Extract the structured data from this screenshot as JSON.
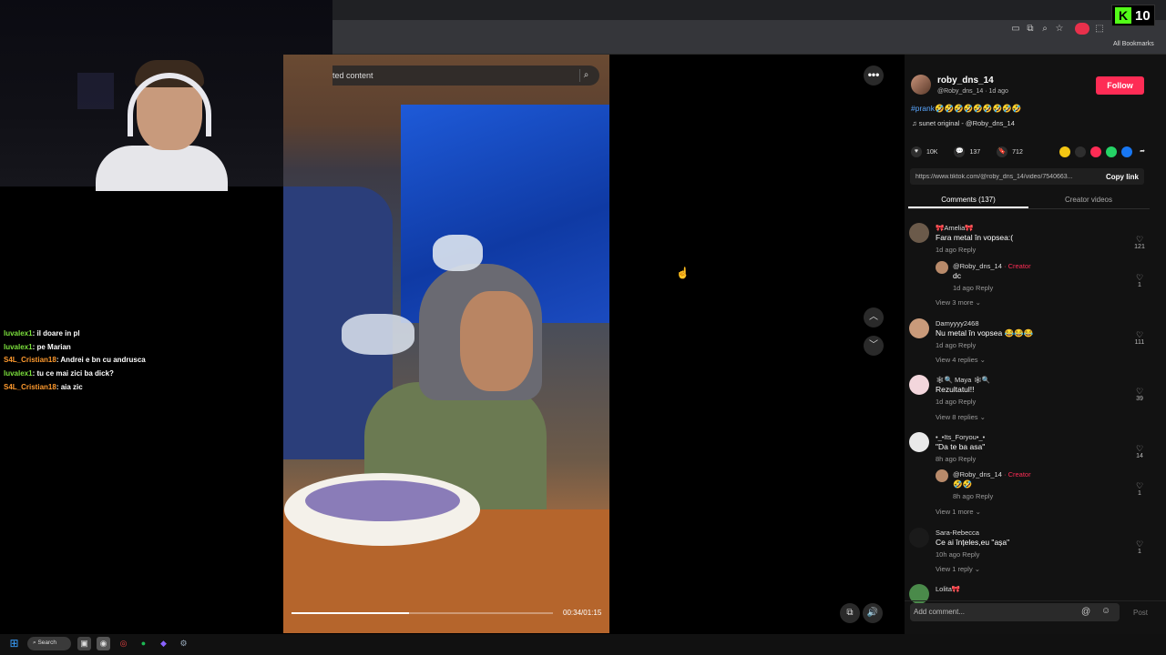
{
  "kick": {
    "count": "10"
  },
  "browser": {
    "all_bookmarks": "All Bookmarks"
  },
  "search": {
    "text": "ted content"
  },
  "video": {
    "time": "00:34/01:15",
    "progress": 0.45
  },
  "chat": [
    {
      "user": "luvalex1",
      "msg": ": il doare in pl",
      "color": "#7be03c"
    },
    {
      "user": "luvalex1",
      "msg": ": pe Marian",
      "color": "#7be03c"
    },
    {
      "user": "S4L_Cristian18",
      "msg": ": Andrei e bn cu andrusca",
      "color": "#ff9a2e"
    },
    {
      "user": "luvalex1",
      "msg": ": tu ce mai zici ba dick?",
      "color": "#7be03c"
    },
    {
      "user": "S4L_Cristian18",
      "msg": ": aia zic",
      "color": "#ff9a2e"
    }
  ],
  "author": {
    "name": "roby_dns_14",
    "sub": "@Roby_dns_14 · 1d ago",
    "follow": "Follow",
    "caption_tag": "#prank",
    "caption_emoji": "🤣🤣🤣🤣🤣🤣🤣🤣🤣",
    "music": "♫  sunet original - @Roby_dns_14"
  },
  "stats": {
    "likes": "10K",
    "comments": "137",
    "saves": "712"
  },
  "link": {
    "url": "https://www.tiktok.com/@roby_dns_14/video/7540663...",
    "copy": "Copy link"
  },
  "tabs": {
    "comments": "Comments (137)",
    "creator": "Creator videos"
  },
  "comments": [
    {
      "name": "🎀Amelia🎀",
      "text": "Fara metal în vopsea:(",
      "meta": "1d ago    Reply",
      "likes": "121"
    },
    {
      "name": "@Roby_dns_14",
      "creator": " · Creator",
      "text": "dc",
      "meta": "1d ago    Reply",
      "likes": "1"
    },
    {
      "more": "View 3 more ⌄"
    },
    {
      "name": "Damyyyy2468",
      "text": "Nu metal în vopsea 😂😂😂",
      "meta": "1d ago    Reply",
      "likes": "111"
    },
    {
      "more": "View 4 replies ⌄"
    },
    {
      "name": "🕸🔍 Maya 🕸🔍",
      "text": "Rezultatul!!",
      "meta": "1d ago    Reply",
      "likes": "39"
    },
    {
      "more": "View 8 replies ⌄"
    },
    {
      "name": "•_•Its_Foryou•_•",
      "text": "\"Da te ba asa\"",
      "meta": "8h ago    Reply",
      "likes": "14"
    },
    {
      "name": "@Roby_dns_14",
      "creator": " · Creator",
      "text": "🤣🤣",
      "meta": "8h ago    Reply",
      "likes": "1"
    },
    {
      "more": "View 1 more ⌄"
    },
    {
      "name": "Sara-Rebecca",
      "text": "Ce ai înțeles,eu \"așa\"",
      "meta": "10h ago    Reply",
      "likes": "1"
    },
    {
      "more": "View 1 reply ⌄"
    },
    {
      "name": "Lolita🎀"
    }
  ],
  "composer": {
    "placeholder": "Add comment...",
    "post": "Post"
  },
  "taskbar": {
    "search": "Search"
  },
  "colors": {
    "accent": "#fe2c55",
    "kick": "#53fc18",
    "link_blue": "#5aa7ff"
  }
}
